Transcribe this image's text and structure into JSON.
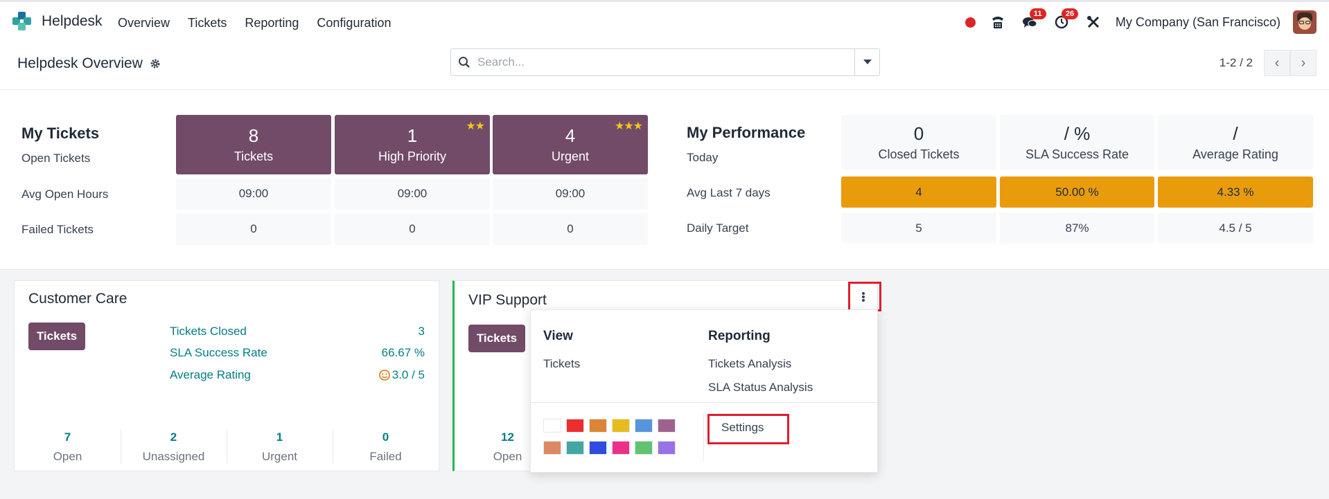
{
  "app": {
    "name": "Helpdesk",
    "menu": [
      "Overview",
      "Tickets",
      "Reporting",
      "Configuration"
    ],
    "company": "My Company (San Francisco)",
    "badges": {
      "messages": "11",
      "activities": "26"
    }
  },
  "control_panel": {
    "title": "Helpdesk Overview",
    "search_placeholder": "Search...",
    "pager": "1-2 / 2"
  },
  "my_tickets": {
    "title": "My Tickets",
    "row_labels": [
      "Open Tickets",
      "Avg Open Hours",
      "Failed Tickets"
    ],
    "columns": [
      {
        "count": "8",
        "label": "Tickets",
        "stars": "",
        "avg_hours": "09:00",
        "failed": "0"
      },
      {
        "count": "1",
        "label": "High Priority",
        "stars": "★★",
        "avg_hours": "09:00",
        "failed": "0"
      },
      {
        "count": "4",
        "label": "Urgent",
        "stars": "★★★",
        "avg_hours": "09:00",
        "failed": "0"
      }
    ]
  },
  "my_performance": {
    "title": "My Performance",
    "row_labels": [
      "Today",
      "Avg Last 7 days",
      "Daily Target"
    ],
    "columns": [
      {
        "today": "0",
        "label": "Closed Tickets",
        "avg7": "4",
        "target": "5"
      },
      {
        "today": "/ %",
        "label": "SLA Success Rate",
        "avg7": "50.00 %",
        "target": "87%"
      },
      {
        "today": "/",
        "label": "Average Rating",
        "avg7": "4.33 %",
        "target": "4.5 / 5"
      }
    ]
  },
  "teams": [
    {
      "name": "Customer Care",
      "button": "Tickets",
      "stats": [
        {
          "label": "Tickets Closed",
          "value": "3"
        },
        {
          "label": "SLA Success Rate",
          "value": "66.67 %"
        },
        {
          "label": "Average Rating",
          "value": "3.0 / 5"
        }
      ],
      "footer": [
        {
          "value": "7",
          "label": "Open"
        },
        {
          "value": "2",
          "label": "Unassigned"
        },
        {
          "value": "1",
          "label": "Urgent"
        },
        {
          "value": "0",
          "label": "Failed"
        }
      ]
    },
    {
      "name": "VIP Support",
      "button": "Tickets",
      "footer": [
        {
          "value": "12",
          "label": "Open"
        }
      ]
    }
  ],
  "dropdown": {
    "view_heading": "View",
    "view_items": [
      "Tickets"
    ],
    "reporting_heading": "Reporting",
    "reporting_items": [
      "Tickets Analysis",
      "SLA Status Analysis"
    ],
    "settings": "Settings",
    "colors": [
      "#ffffff",
      "#ee2d2d",
      "#dc8534",
      "#e8bb1d",
      "#5794dd",
      "#9f628f",
      "#db8865",
      "#41a9a2",
      "#304be0",
      "#ee2f8a",
      "#61c36e",
      "#9872e6"
    ]
  }
}
